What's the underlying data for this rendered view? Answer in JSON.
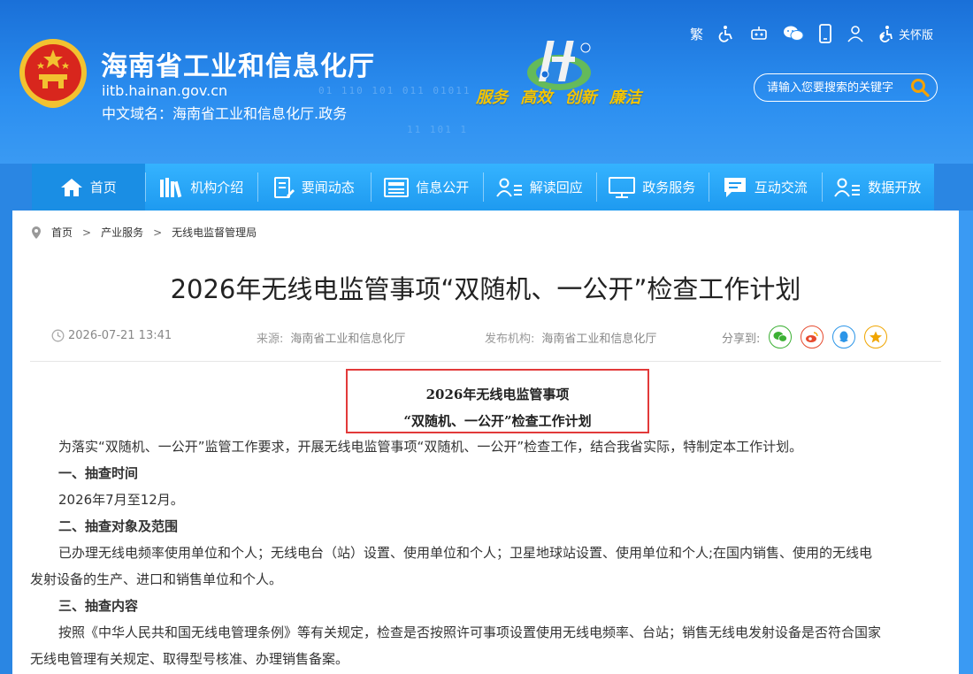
{
  "header": {
    "site_title": "海南省工业和信息化厅",
    "domain": "iitb.hainan.gov.cn",
    "cn_domain": "中文域名：海南省工业和信息化厅.政务",
    "slogan": [
      "服务",
      "高效",
      "创新",
      "廉洁"
    ],
    "binary_1": "01 110 101 011 01011",
    "binary_2": "11 101 1",
    "tools": {
      "traditional": "繁",
      "care_mode": "关怀版"
    },
    "search": {
      "placeholder": "请输入您要搜索的关键字"
    }
  },
  "nav": [
    {
      "label": "首页",
      "icon": "home-icon"
    },
    {
      "label": "机构介绍",
      "icon": "books-icon"
    },
    {
      "label": "要闻动态",
      "icon": "document-edit-icon"
    },
    {
      "label": "信息公开",
      "icon": "newspaper-icon"
    },
    {
      "label": "解读回应",
      "icon": "user-list-icon"
    },
    {
      "label": "政务服务",
      "icon": "monitor-icon"
    },
    {
      "label": "互动交流",
      "icon": "chat-icon"
    },
    {
      "label": "数据开放",
      "icon": "user-data-icon"
    }
  ],
  "breadcrumb": [
    "首页",
    "产业服务",
    "无线电监督管理局"
  ],
  "article": {
    "title": "2026年无线电监管事项“双随机、一公开”检查工作计划",
    "datetime": "2026-07-21 13:41",
    "source_label": "来源:",
    "source": "海南省工业和信息化厅",
    "publisher_label": "发布机构:",
    "publisher": "海南省工业和信息化厅",
    "share_label": "分享到:",
    "doc_heading_1": "2026年无线电监管事项",
    "doc_heading_2": "“双随机、一公开”检查工作计划",
    "paragraphs": {
      "intro": "为落实“双随机、一公开”监管工作要求，开展无线电监管事项“双随机、一公开”检查工作，结合我省实际，特制定本工作计划。",
      "h1": "一、抽查时间",
      "p1": "2026年7月至12月。",
      "h2": "二、抽查对象及范围",
      "p2a": "已办理无线电频率使用单位和个人；无线电台（站）设置、使用单位和个人；卫星地球站设置、使用单位和个人;在国内销售、使用的无线电",
      "p2b": "发射设备的生产、进口和销售单位和个人。",
      "h3": "三、抽查内容",
      "p3a": "按照《中华人民共和国无线电管理条例》等有关规定，检查是否按照许可事项设置使用无线电频率、台站；销售无线电发射设备是否符合国家",
      "p3b": "无线电管理有关规定、取得型号核准、办理销售备案。"
    }
  },
  "colors": {
    "header_blue": "#1a70d8",
    "nav_blue": "#1e9af0",
    "slogan_gold": "#f5c400",
    "highlight_red": "#e23a3a"
  }
}
